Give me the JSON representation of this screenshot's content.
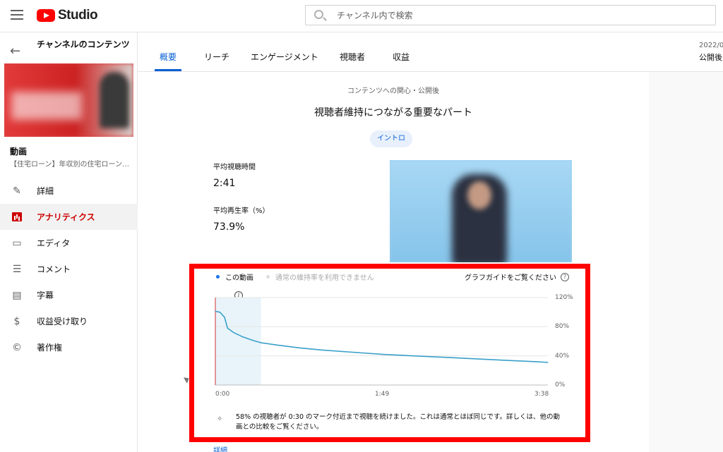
{
  "header": {
    "logo_text": "Studio",
    "search_placeholder": "チャンネル内で検索"
  },
  "sidebar": {
    "title": "チャンネルのコンテンツ",
    "video_label": "動画",
    "video_title": "【住宅ローン】年収別の住宅ローン…",
    "items": [
      {
        "label": "詳細",
        "icon": "pencil-icon",
        "active": false
      },
      {
        "label": "アナリティクス",
        "icon": "analytics-icon",
        "active": true
      },
      {
        "label": "エディタ",
        "icon": "editor-icon",
        "active": false
      },
      {
        "label": "コメント",
        "icon": "comment-icon",
        "active": false
      },
      {
        "label": "字幕",
        "icon": "subtitles-icon",
        "active": false
      },
      {
        "label": "収益受け取り",
        "icon": "dollar-icon",
        "active": false
      },
      {
        "label": "著作権",
        "icon": "copyright-icon",
        "active": false
      }
    ]
  },
  "tabs": [
    {
      "label": "概要",
      "active": true
    },
    {
      "label": "リーチ",
      "active": false
    },
    {
      "label": "エンゲージメント",
      "active": false
    },
    {
      "label": "視聴者",
      "active": false
    },
    {
      "label": "収益",
      "active": false
    }
  ],
  "right_panel": {
    "date": "2022/0",
    "sub": "公開後"
  },
  "card": {
    "subtitle": "コンテンツへの関心・公開後",
    "title": "視聴者維持につながる重要なパート",
    "chip": "イントロ",
    "stats": [
      {
        "label": "平均視聴時間",
        "value": "2:41"
      },
      {
        "label": "平均再生率（%）",
        "value": "73.9%"
      }
    ]
  },
  "chart_panel": {
    "legend": [
      {
        "label": "この動画",
        "color": "#1a73e8"
      },
      {
        "label": "通常の維持率を利用できません",
        "color": "#dddddd"
      }
    ],
    "guide_label": "グラフガイドをご覧ください",
    "insight": "58% の視聴者が 0:30 のマーク付近まで視聴を続けました。これは通常とほぼ同じです。詳しくは、他の動画との比較をご覧ください。",
    "more_link": "詳細"
  },
  "chart_data": {
    "type": "line",
    "xlabel": "",
    "ylabel": "",
    "xlim": [
      0,
      218
    ],
    "ylim": [
      0,
      120
    ],
    "x_ticks": [
      "0:00",
      "1:49",
      "3:38"
    ],
    "y_ticks": [
      "120%",
      "80%",
      "40%",
      "0%"
    ],
    "highlight_range": [
      0,
      30
    ],
    "series": [
      {
        "name": "この動画",
        "color": "#3aa0c9",
        "x": [
          0,
          3,
          6,
          8,
          12,
          18,
          25,
          30,
          40,
          55,
          70,
          90,
          110,
          130,
          150,
          170,
          190,
          210,
          218
        ],
        "y": [
          101,
          100,
          93,
          78,
          72,
          66,
          61,
          58,
          55,
          51,
          48,
          45,
          42,
          40,
          38,
          36,
          34,
          32,
          31
        ]
      }
    ]
  }
}
